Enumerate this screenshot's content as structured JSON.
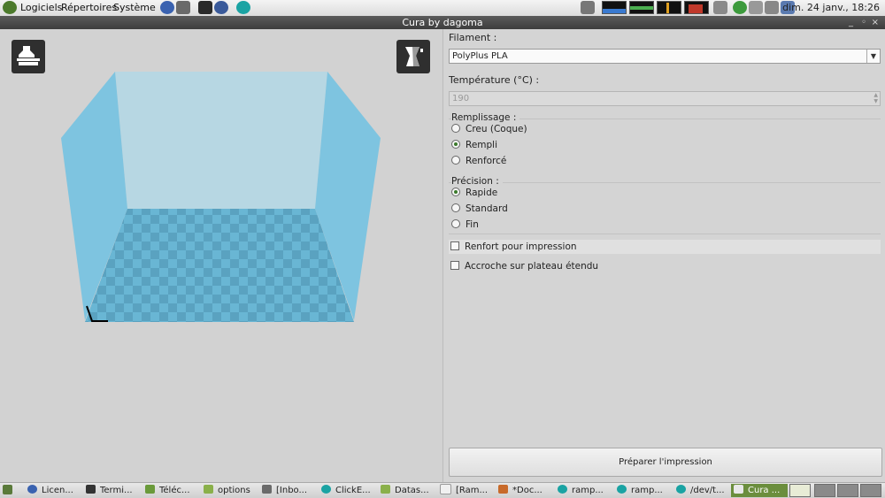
{
  "top_panel": {
    "menus": [
      "Logiciels",
      "Répertoires",
      "Système"
    ],
    "clock": "dim. 24 janv., 18:26"
  },
  "window": {
    "title": "Cura by dagoma",
    "controls": [
      "_",
      "◦",
      "×"
    ]
  },
  "settings": {
    "filament_label": "Filament :",
    "filament_value": "PolyPlus PLA",
    "temperature_label": "Température (°C) :",
    "temperature_value": "190",
    "infill_label": "Remplissage :",
    "infill_options": [
      {
        "label": "Creu (Coque)",
        "selected": false
      },
      {
        "label": "Rempli",
        "selected": true
      },
      {
        "label": "Renforcé",
        "selected": false
      }
    ],
    "precision_label": "Précision :",
    "precision_options": [
      {
        "label": "Rapide",
        "selected": true
      },
      {
        "label": "Standard",
        "selected": false
      },
      {
        "label": "Fin",
        "selected": false
      }
    ],
    "support_label": "Renfort pour impression",
    "adhesion_label": "Accroche sur plateau étendu",
    "prepare_button": "Préparer l'impression"
  },
  "taskbar": {
    "items": [
      "Licen...",
      "Termi...",
      "Téléc...",
      "options",
      "[Inbo...",
      "ClickE...",
      "Datas...",
      "[Ram...",
      "*Doc...",
      "ramp...",
      "ramp...",
      "/dev/t...",
      "Cura ..."
    ]
  },
  "colors": {
    "build_volume": "#7ec4e0",
    "accent_active_task": "#6b8e3d"
  },
  "icons": {
    "load_model": "load-model-icon",
    "view_mode": "view-mode-icon"
  }
}
